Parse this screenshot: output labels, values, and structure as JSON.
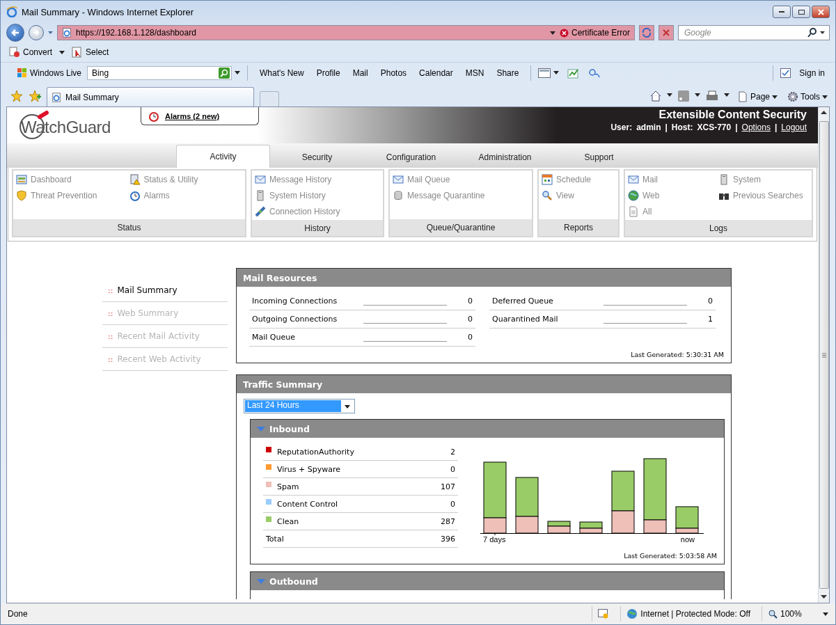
{
  "browser": {
    "title": "Mail Summary - Windows Internet Explorer",
    "address": "https://192.168.1.128/dashboard",
    "certificate_error": "Certificate Error",
    "search_placeholder": "Google",
    "command_bar": [
      {
        "label": "Convert",
        "kind": "convert"
      },
      {
        "label": "Select",
        "kind": "select"
      }
    ],
    "live_bar": {
      "brand": "Windows Live",
      "search_value": "Bing",
      "links": [
        "What's New",
        "Profile",
        "Mail",
        "Photos",
        "Calendar",
        "MSN",
        "Share"
      ],
      "sign_in": "Sign in"
    },
    "tab": {
      "label": "Mail Summary"
    },
    "tools": [
      {
        "label": "Page",
        "kind": "page"
      },
      {
        "label": "Tools",
        "kind": "gear"
      }
    ]
  },
  "page": {
    "header": {
      "logo": "WatchGuard",
      "alarm": "Alarms (2 new)",
      "product": "Extensible Content Security",
      "user_label": "User:",
      "user": "admin",
      "host_label": "Host:",
      "host": "XCS-770",
      "separator": "|",
      "links": [
        "Options",
        "Logout"
      ]
    },
    "nav_tabs": [
      {
        "label": "Activity",
        "selected": true
      },
      {
        "label": "Security",
        "selected": false
      },
      {
        "label": "Configuration",
        "selected": false
      },
      {
        "label": "Administration",
        "selected": false
      },
      {
        "label": "Support",
        "selected": false
      }
    ],
    "menu_groups": [
      {
        "title": "Status",
        "columns": [
          [
            {
              "label": "Dashboard",
              "kind": "dashboard"
            },
            {
              "label": "Threat Prevention",
              "kind": "shield"
            }
          ],
          [
            {
              "label": "Status & Utility",
              "kind": "calculator"
            },
            {
              "label": "Alarms",
              "kind": "clock"
            }
          ]
        ]
      },
      {
        "title": "History",
        "columns": [
          [
            {
              "label": "Message History",
              "kind": "envelope"
            },
            {
              "label": "System History",
              "kind": "server"
            },
            {
              "label": "Connection History",
              "kind": "plug"
            }
          ]
        ]
      },
      {
        "title": "Queue/Quarantine",
        "columns": [
          [
            {
              "label": "Mail Queue",
              "kind": "envelope"
            },
            {
              "label": "Message Quarantine",
              "kind": "database"
            }
          ]
        ]
      },
      {
        "title": "Reports",
        "columns": [
          [
            {
              "label": "Schedule",
              "kind": "calendar"
            },
            {
              "label": "View",
              "kind": "magnifier"
            }
          ]
        ]
      },
      {
        "title": "Logs",
        "columns": [
          [
            {
              "label": "Mail",
              "kind": "envelope"
            },
            {
              "label": "Web",
              "kind": "globe"
            },
            {
              "label": "All",
              "kind": "document"
            }
          ],
          [
            {
              "label": "System",
              "kind": "server"
            },
            {
              "label": "Previous Searches",
              "kind": "binoculars"
            }
          ]
        ]
      }
    ],
    "side_nav": [
      {
        "bullet": "::",
        "label": "Mail Summary",
        "selected": true
      },
      {
        "bullet": "::",
        "label": "Web Summary",
        "selected": false
      },
      {
        "bullet": "::",
        "label": "Recent Mail Activity",
        "selected": false
      },
      {
        "bullet": "::",
        "label": "Recent Web Activity",
        "selected": false
      }
    ],
    "mail_resources": {
      "title": "Mail Resources",
      "left": [
        {
          "label": "Incoming Connections",
          "value": "0"
        },
        {
          "label": "Outgoing Connections",
          "value": "0"
        },
        {
          "label": "Mail Queue",
          "value": "0"
        }
      ],
      "right": [
        {
          "label": "Deferred Queue",
          "value": "0"
        },
        {
          "label": "Quarantined Mail",
          "value": "1"
        }
      ],
      "last_generated": "Last Generated: 5:30:31 AM"
    },
    "traffic_summary": {
      "title": "Traffic Summary",
      "period": "Last 24 Hours",
      "inbound": {
        "title": "Inbound",
        "expanded": true,
        "rows": [
          {
            "label": "ReputationAuthority",
            "value": "2",
            "color": "#cc0000"
          },
          {
            "label": "Virus + Spyware",
            "value": "0",
            "color": "#ff9933"
          },
          {
            "label": "Spam",
            "value": "107",
            "color": "#eec0b8"
          },
          {
            "label": "Content Control",
            "value": "0",
            "color": "#99ccff"
          },
          {
            "label": "Clean",
            "value": "287",
            "color": "#99cc66"
          }
        ],
        "total": {
          "label": "Total",
          "value": "396"
        },
        "chart_start": "7 days",
        "chart_end": "now",
        "last_generated": "Last Generated: 5:03:58 AM"
      },
      "outbound": {
        "title": "Outbound",
        "expanded": true
      }
    }
  },
  "status_bar": {
    "text": "Done",
    "zone": "Internet | Protected Mode: Off",
    "zoom": "100%"
  }
}
